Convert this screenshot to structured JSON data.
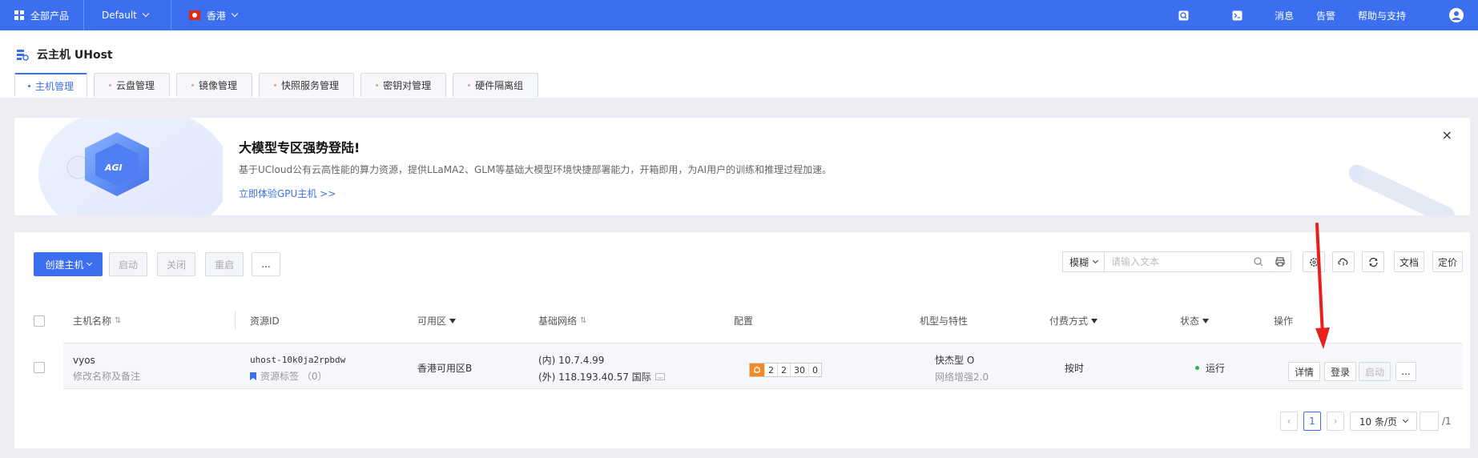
{
  "topbar": {
    "all_products": "全部产品",
    "project": "Default",
    "region": "香港",
    "messages": "消息",
    "alerts": "告警",
    "help": "帮助与支持"
  },
  "header": {
    "title": "云主机 UHost",
    "tabs": [
      {
        "label": "主机管理"
      },
      {
        "label": "云盘管理"
      },
      {
        "label": "镜像管理"
      },
      {
        "label": "快照服务管理"
      },
      {
        "label": "密钥对管理"
      },
      {
        "label": "硬件隔离组"
      }
    ]
  },
  "banner": {
    "badge": "AGI",
    "title": "大模型专区强势登陆!",
    "desc": "基于UCloud公有云高性能的算力资源，提供LLaMA2、GLM等基础大模型环境快捷部署能力，开箱即用，为AI用户的训练和推理过程加速。",
    "link": "立即体验GPU主机 >>",
    "close": "×"
  },
  "toolbar": {
    "create": "创建主机",
    "start": "启动",
    "shutdown": "关闭",
    "restart": "重启",
    "more": "...",
    "search_mode": "模糊",
    "search_placeholder": "请输入文本",
    "docs": "文档",
    "pricing": "定价"
  },
  "table": {
    "headers": {
      "name": "主机名称",
      "resource_id": "资源ID",
      "zone": "可用区",
      "network": "基础网络",
      "config": "配置",
      "type": "机型与特性",
      "billing": "付费方式",
      "status": "状态",
      "actions": "操作"
    },
    "rows": [
      {
        "name": "vyos",
        "remark": "修改名称及备注",
        "resource_id": "uhost-10k0ja2rpbdw",
        "tags": "资源标签 （0）",
        "zone": "香港可用区B",
        "ip_internal": "(内) 10.7.4.99",
        "ip_external": "(外) 118.193.40.57 国际",
        "config": [
          "2",
          "2",
          "30",
          "0"
        ],
        "type": "快杰型 O",
        "type_sub": "网络增强2.0",
        "billing": "按时",
        "status": "运行",
        "status_color": "#2bb24c",
        "btn_detail": "详情",
        "btn_login": "登录",
        "btn_start": "启动",
        "btn_more": "..."
      }
    ]
  },
  "pagination": {
    "prev": "‹",
    "current": "1",
    "next": "›",
    "page_size": "10 条/页",
    "total": "/1"
  },
  "colors": {
    "accent": "#3b6ff0",
    "arrow": "#e8201c"
  }
}
